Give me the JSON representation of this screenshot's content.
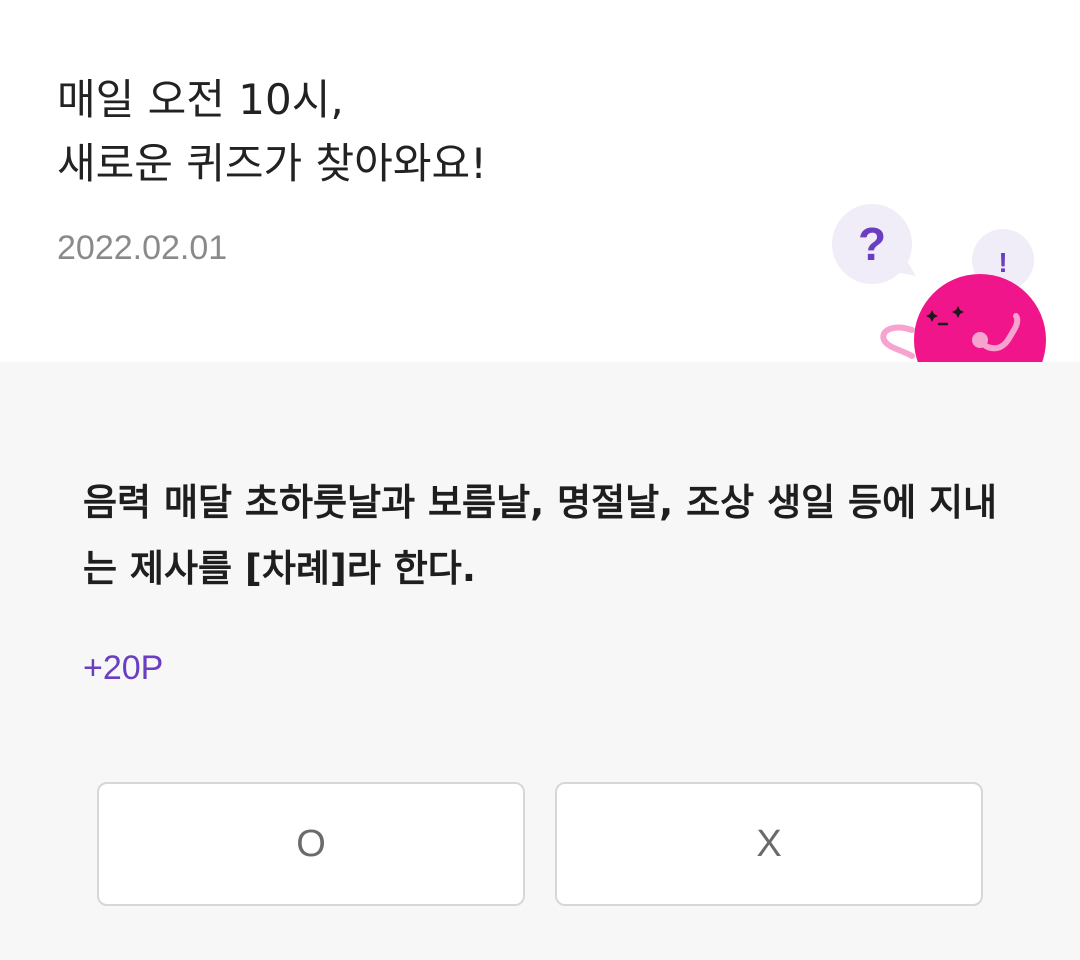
{
  "header": {
    "title_line1": "매일 오전 10시,",
    "title_line2": "새로운 퀴즈가 찾아와요!",
    "date": "2022.02.01",
    "mascot": {
      "bubble_left": "?",
      "bubble_right": "!"
    }
  },
  "quiz": {
    "question": "음력 매달 초하룻날과 보름날, 명절날, 조상 생일 등에 지내는 제사를 [차례]라 한다.",
    "points": "+20P",
    "answers": {
      "o_label": "O",
      "x_label": "X"
    }
  },
  "colors": {
    "accent_purple": "#6a3ec1",
    "mascot_pink": "#f0158a",
    "background": "#f7f7f7"
  }
}
